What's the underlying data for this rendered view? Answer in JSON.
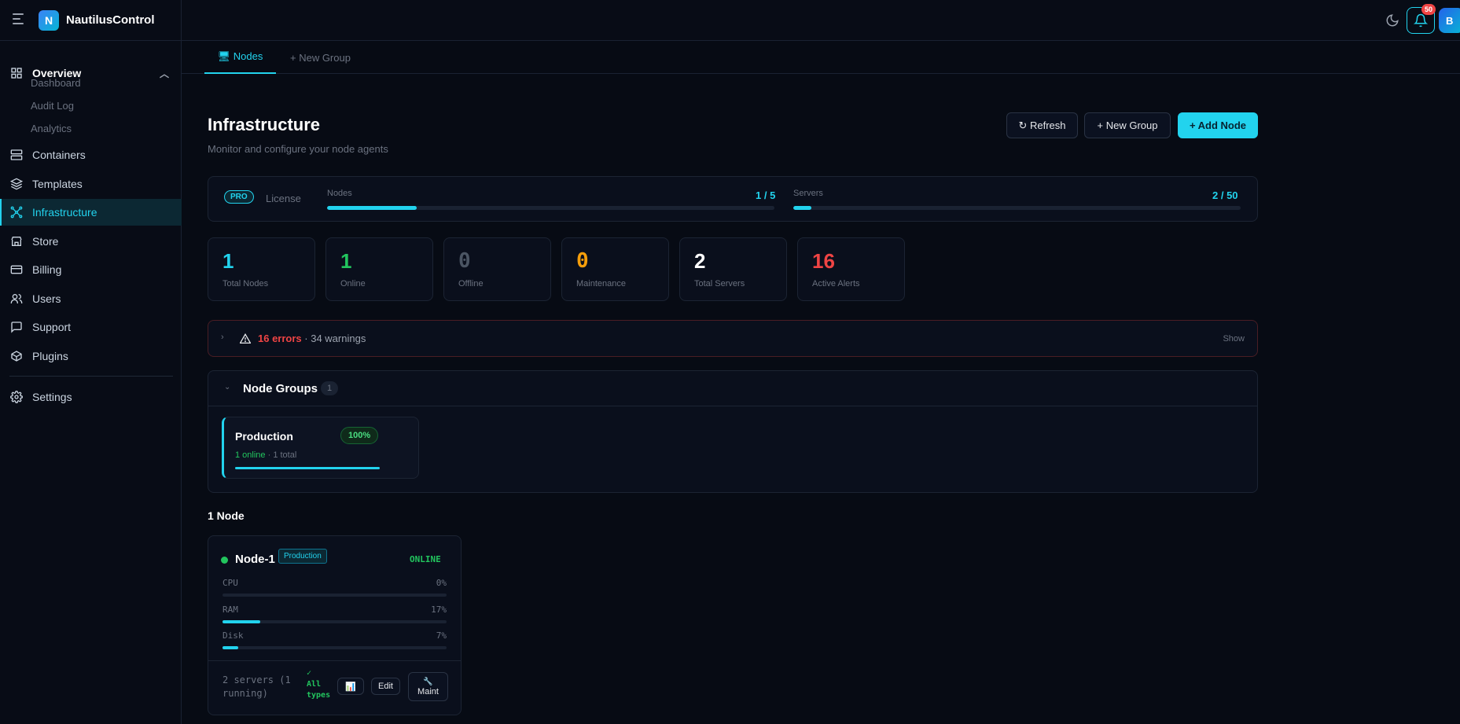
{
  "app": {
    "name": "NautilusControl",
    "logo_letter": "N"
  },
  "header": {
    "notifications_count": "50",
    "avatar_initial": "B",
    "theme_icon": "moon-icon",
    "bell_icon": "bell-icon"
  },
  "sidebar": {
    "overview": {
      "label": "Overview",
      "children": [
        "Dashboard",
        "Audit Log",
        "Analytics"
      ]
    },
    "items": [
      {
        "label": "Containers",
        "icon": "containers-icon"
      },
      {
        "label": "Templates",
        "icon": "layers-icon"
      },
      {
        "label": "Infrastructure",
        "icon": "network-icon",
        "active": true
      },
      {
        "label": "Store",
        "icon": "store-icon"
      },
      {
        "label": "Billing",
        "icon": "credit-card-icon"
      },
      {
        "label": "Users",
        "icon": "users-icon"
      },
      {
        "label": "Support",
        "icon": "message-icon"
      },
      {
        "label": "Plugins",
        "icon": "box-icon"
      }
    ],
    "settings": {
      "label": "Settings",
      "icon": "gear-icon"
    }
  },
  "tabs": [
    {
      "label": "🖥 Nodes",
      "active": true
    },
    {
      "label": "+ New Group",
      "active": false
    }
  ],
  "page": {
    "title": "Infrastructure",
    "subtitle": "Monitor and configure your node agents",
    "buttons": {
      "refresh": "↻ Refresh",
      "new_group": "+ New Group",
      "add_node": "+ Add Node"
    }
  },
  "license": {
    "badge": "PRO",
    "label": "License",
    "nodes": {
      "label": "Nodes",
      "value": "1 / 5",
      "fraction": 0.2
    },
    "servers": {
      "label": "Servers",
      "value": "2 / 50",
      "fraction": 0.04
    }
  },
  "stats": [
    {
      "value": "1",
      "label": "Total Nodes",
      "color": "#22d3ee"
    },
    {
      "value": "1",
      "label": "Online",
      "color": "#22c55e"
    },
    {
      "value": "0",
      "label": "Offline",
      "color": "#4b5563"
    },
    {
      "value": "0",
      "label": "Maintenance",
      "color": "#f59e0b"
    },
    {
      "value": "2",
      "label": "Total Servers",
      "color": "#ffffff"
    },
    {
      "value": "16",
      "label": "Active Alerts",
      "color": "#ef4444"
    }
  ],
  "alerts": {
    "errors": "16 errors",
    "separator": " · ",
    "warnings": "34 warnings",
    "show": "Show"
  },
  "node_groups": {
    "title": "Node Groups",
    "count": "1",
    "groups": [
      {
        "name": "Production",
        "percent": "100%",
        "online": "1 online",
        "total": " · 1 total",
        "fraction": 1.0
      }
    ]
  },
  "nodes_heading": "1 Node",
  "nodes": [
    {
      "name": "Node-1",
      "group": "Production",
      "status": "ONLINE",
      "metrics": [
        {
          "label": "CPU",
          "value": "0%",
          "fraction": 0.0
        },
        {
          "label": "RAM",
          "value": "17%",
          "fraction": 0.17
        },
        {
          "label": "Disk",
          "value": "7%",
          "fraction": 0.07
        }
      ],
      "servers_text": "2 servers (1 running)",
      "types_check": "✓",
      "types_line1": "All",
      "types_line2": "types",
      "chart_button": "📊",
      "edit_button": "Edit",
      "maint_icon": "🔧",
      "maint_label": "Maint"
    }
  ]
}
